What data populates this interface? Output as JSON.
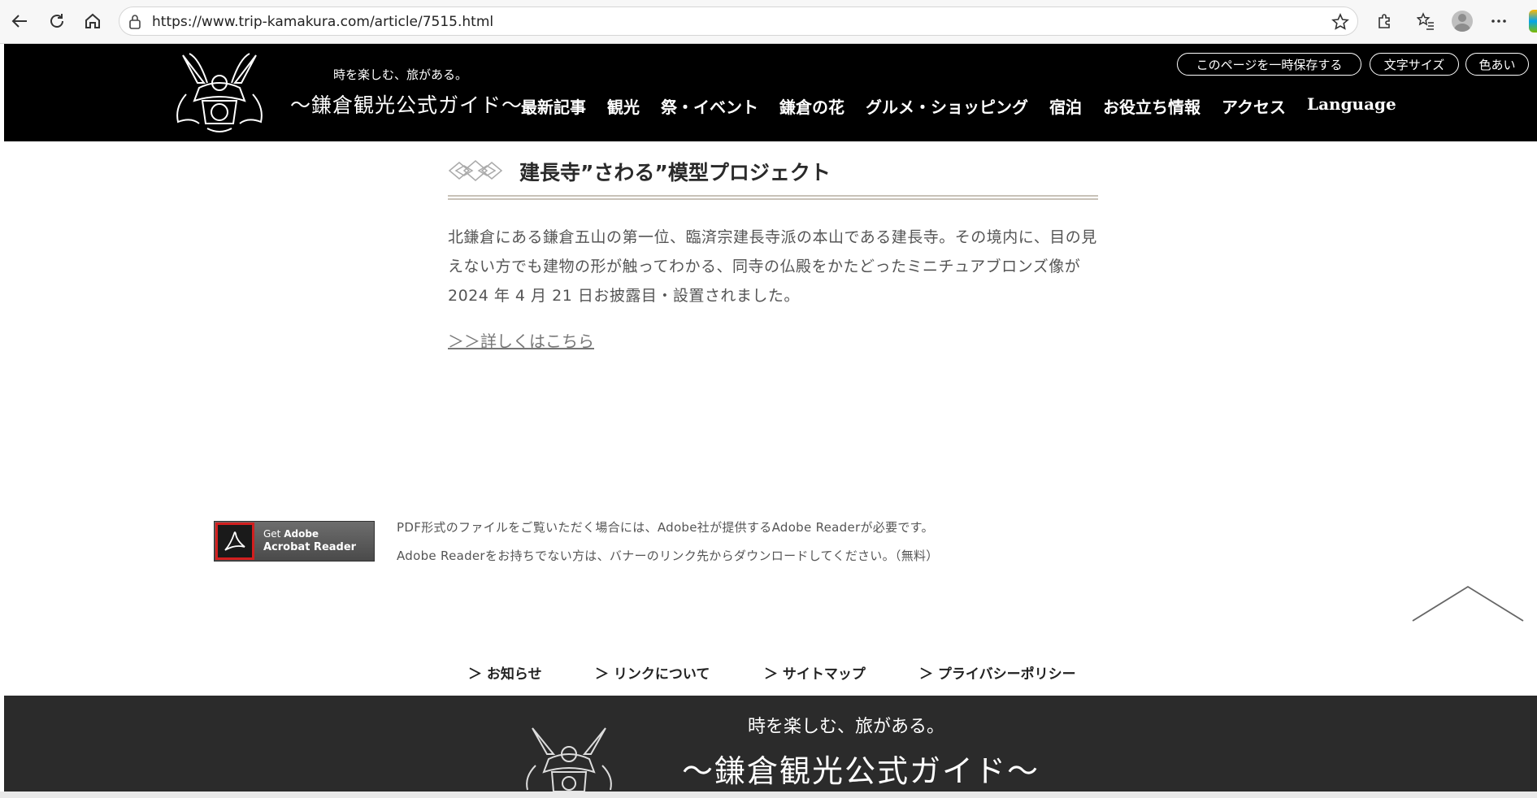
{
  "browser": {
    "url": "https://www.trip-kamakura.com/article/7515.html"
  },
  "header": {
    "tagline": "時を楽しむ、旅がある。",
    "title": "～鎌倉観光公式ガイド～",
    "nav": [
      "最新記事",
      "観光",
      "祭・イベント",
      "鎌倉の花",
      "グルメ・ショッピング",
      "宿泊",
      "お役立ち情報",
      "アクセス",
      "Language"
    ],
    "utility": {
      "save": "このページを一時保存する",
      "font_size": "文字サイズ",
      "color": "色あい"
    }
  },
  "article": {
    "heading": "建長寺”さわる”模型プロジェクト",
    "body": "北鎌倉にある鎌倉五山の第一位、臨済宗建長寺派の本山である建長寺。その境内に、目の見えない方でも建物の形が触ってわかる、同寺の仏殿をかたどったミニチュアブロンズ像が2024 年 4 月 21 日お披露目・設置されました。",
    "more_link": "＞＞詳しくはこちら"
  },
  "acrobat": {
    "get": "Get",
    "adobe": "Adobe",
    "reader": "Acrobat Reader",
    "note1": "PDF形式のファイルをご覧いただく場合には、Adobe社が提供するAdobe Readerが必要です。",
    "note2": "Adobe Readerをお持ちでない方は、バナーのリンク先からダウンロードしてください。（無料）"
  },
  "footer_links": [
    "＞ お知らせ",
    "＞ リンクについて",
    "＞ サイトマップ",
    "＞ プライバシーポリシー"
  ],
  "footer": {
    "tagline": "時を楽しむ、旅がある。",
    "title": "～鎌倉観光公式ガイド～"
  }
}
